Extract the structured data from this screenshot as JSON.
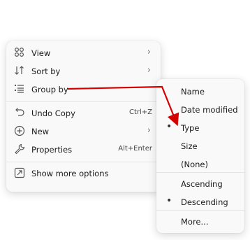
{
  "context_menu": {
    "items": [
      {
        "label": "View",
        "has_submenu": true
      },
      {
        "label": "Sort by",
        "has_submenu": true
      },
      {
        "label": "Group by",
        "has_submenu": true,
        "expanded": true
      },
      {
        "label": "Undo Copy",
        "shortcut": "Ctrl+Z"
      },
      {
        "label": "New",
        "has_submenu": true
      },
      {
        "label": "Properties",
        "shortcut": "Alt+Enter"
      },
      {
        "label": "Show more options"
      }
    ]
  },
  "group_by_submenu": {
    "items": [
      {
        "label": "Name"
      },
      {
        "label": "Date modified"
      },
      {
        "label": "Type",
        "selected": true
      },
      {
        "label": "Size"
      },
      {
        "label": "(None)"
      },
      {
        "label": "Ascending"
      },
      {
        "label": "Descending",
        "selected": true
      },
      {
        "label": "More..."
      }
    ]
  },
  "colors": {
    "annotation_arrow": "#d40000",
    "menu_bg": "#f9f9f9"
  }
}
